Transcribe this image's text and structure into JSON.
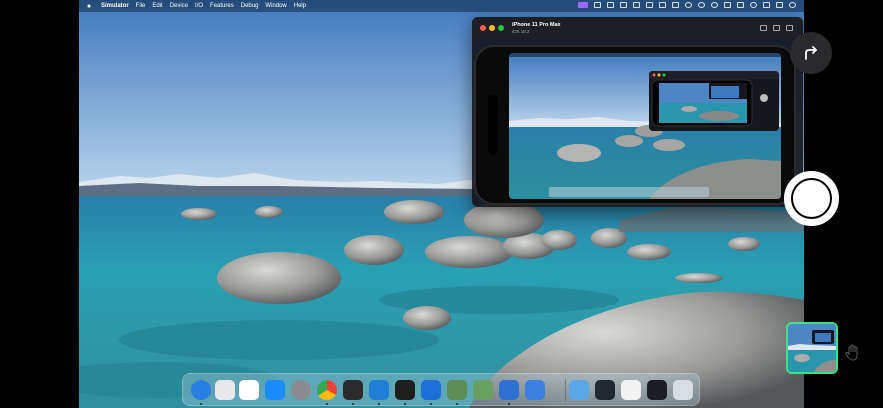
{
  "menubar": {
    "app_name": "Simulator",
    "menus": [
      "File",
      "Edit",
      "Device",
      "I/O",
      "Features",
      "Debug",
      "Window",
      "Help"
    ]
  },
  "simulator_window": {
    "device_name": "iPhone 11 Pro Max",
    "os_version": "iOS 18.2"
  },
  "colors": {
    "sky_top": "#4f86c6",
    "water": "#2a96ad",
    "accent_green": "#3ee08a",
    "close": "#ff5f57",
    "minimize": "#febc2e",
    "maximize": "#28c840"
  },
  "dock": {
    "icons": [
      {
        "name": "finder-icon",
        "color": "#2a7de1"
      },
      {
        "name": "launchpad-icon",
        "color": "#e8e8ec"
      },
      {
        "name": "calendar-icon",
        "color": "#ffffff"
      },
      {
        "name": "app-store-icon",
        "color": "#1a8cff"
      },
      {
        "name": "system-settings-icon",
        "color": "#8a8a90"
      },
      {
        "name": "chrome-icon",
        "color": "#e8e8e8"
      },
      {
        "name": "instruments-icon",
        "color": "#2b2b2b"
      },
      {
        "name": "vscode-icon",
        "color": "#1f7fd6"
      },
      {
        "name": "activity-monitor-icon",
        "color": "#1e1e1e"
      },
      {
        "name": "xcode-icon",
        "color": "#1e6fd9"
      },
      {
        "name": "app-green-1-icon",
        "color": "#5c8d55"
      },
      {
        "name": "app-green-2-icon",
        "color": "#6aa060"
      },
      {
        "name": "app-blue-1-icon",
        "color": "#2f6fd1"
      },
      {
        "name": "app-blue-2-icon",
        "color": "#3b7fe0"
      },
      {
        "name": "folder-icon",
        "color": "#5aa8e8"
      },
      {
        "name": "window-thumb-1-icon",
        "color": "#222831"
      },
      {
        "name": "window-thumb-2-icon",
        "color": "#f2f2f2"
      },
      {
        "name": "window-thumb-3-icon",
        "color": "#1b1d22"
      },
      {
        "name": "trash-icon",
        "color": "#d8dde2"
      }
    ]
  }
}
